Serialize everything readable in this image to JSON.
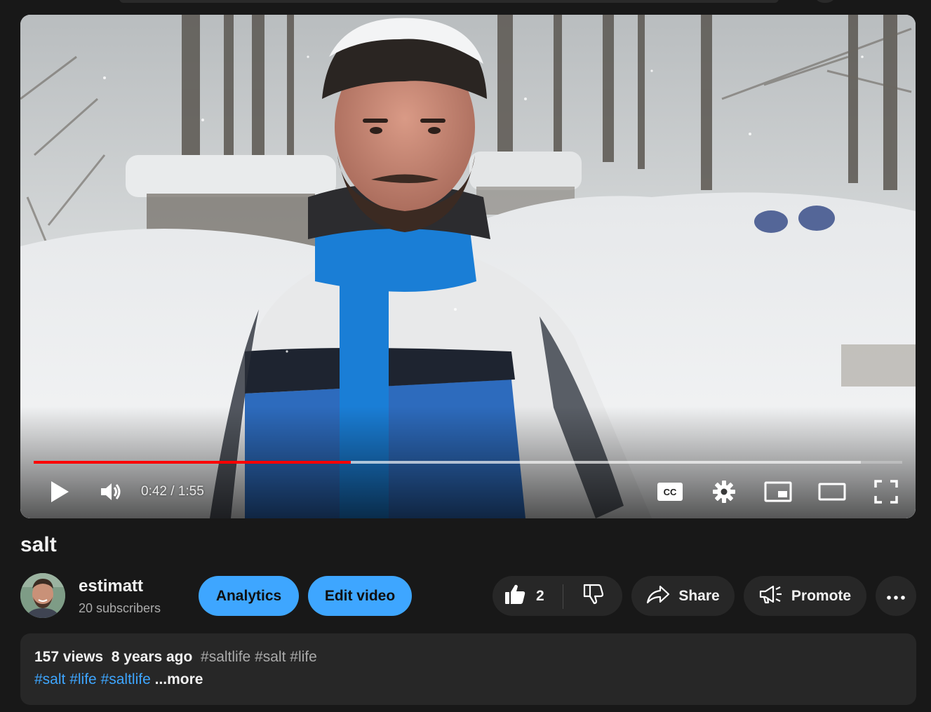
{
  "player": {
    "current_time": "0:42",
    "separator": " / ",
    "duration": "1:55",
    "played_fraction": 0.365,
    "buffered_fraction": 0.952,
    "accent_color": "#ff0000"
  },
  "controls": {
    "play_icon": "play-icon",
    "volume_icon": "volume-icon",
    "captions_icon": "cc-icon",
    "settings_icon": "gear-icon",
    "miniplayer_icon": "miniplayer-icon",
    "theater_icon": "theater-icon",
    "fullscreen_icon": "fullscreen-icon"
  },
  "video": {
    "title": "salt"
  },
  "channel": {
    "name": "estimatt",
    "subscribers": "20 subscribers"
  },
  "actions": {
    "analytics_label": "Analytics",
    "edit_label": "Edit video",
    "like_count": "2",
    "share_label": "Share",
    "promote_label": "Promote",
    "button_blue": "#3ea6ff"
  },
  "description": {
    "views": "157 views",
    "age": "8 years ago",
    "header_tags": [
      "#saltlife",
      "#salt",
      "#life"
    ],
    "link_tags": [
      "#salt",
      "#life",
      "#saltlife"
    ],
    "more_label": "...more"
  }
}
